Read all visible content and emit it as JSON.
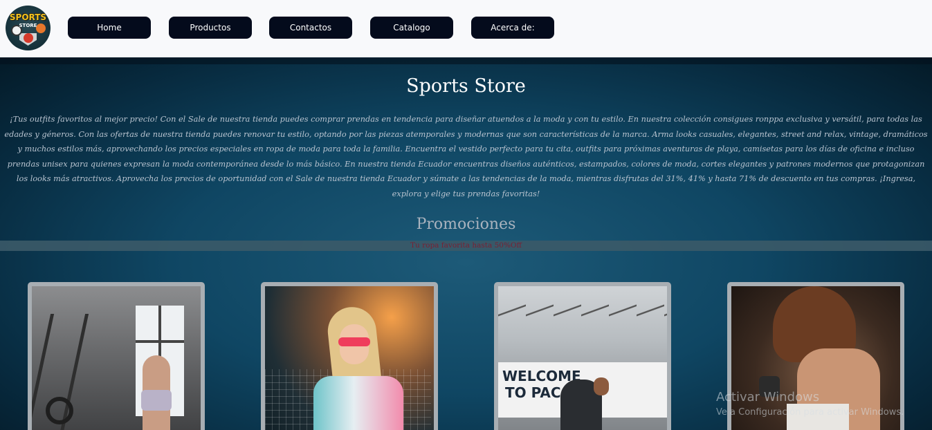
{
  "logo": {
    "line1": "SPORTS",
    "line2": "STORE"
  },
  "nav": {
    "home": "Home",
    "productos": "Productos",
    "contactos": "Contactos",
    "catalogo": "Catalogo",
    "acerca": "Acerca de:"
  },
  "hero": {
    "title": "Sports Store",
    "intro": "¡Tus outfits favoritos al mejor precio! Con el Sale de nuestra tienda puedes comprar prendas en tendencia para diseñar atuendos a la moda y con tu estilo. En nuestra colección consigues ronppa exclusiva y versátil, para todas las edades y géneros. Con las ofertas de nuestra tienda puedes renovar tu estilo, optando por las piezas atemporales y modernas que son características de la marca. Arma looks casuales, elegantes, street and relax, vintage, dramáticos y muchos estilos más, aprovechando los precios especiales en ropa de moda para toda la familia. Encuentra el vestido perfecto para tu cita, outfits para próximas aventuras de playa, camisetas para los días de oficina e incluso prendas unisex para quienes expresan la moda contemporánea desde lo más básico. En nuestra tienda Ecuador encuentras diseños auténticos, estampados, colores de moda, cortes elegantes y patrones modernos que protagonizan los looks más atractivos. Aprovecha los precios de oportunidad con el Sale de nuestra tienda Ecuador y súmate a las tendencias de la moda, mientras disfrutas del 31%, 41% y hasta 71% de descuento en tus compras. ¡Ingresa, explora y elige tus prendas favoritas!"
  },
  "promos": {
    "title": "Promociones",
    "subtitle": "Tu ropa favorita hasta 50%Off"
  },
  "photo3": {
    "sign_line1": "WELCOME",
    "sign_line2": "TO PACA"
  },
  "watermark": {
    "line1": "Activar Windows",
    "line2": "Ve a Configuración para activar Windows."
  },
  "colors": {
    "nav_button_bg": "#040b1c",
    "navbar_bg": "#f8f9fb",
    "hero_bg": "#0f4663",
    "promo_subtitle": "#7a2033"
  }
}
